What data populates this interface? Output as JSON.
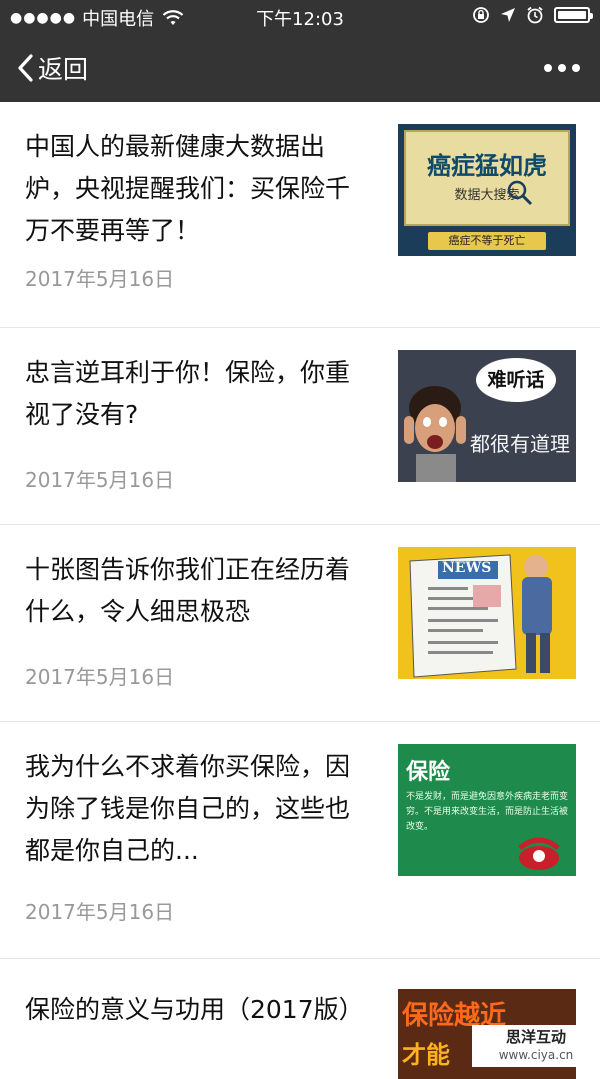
{
  "statusbar": {
    "signal": "●●●●●",
    "carrier": "中国电信",
    "time": "下午12:03"
  },
  "navbar": {
    "back_label": "返回"
  },
  "articles": [
    {
      "title": "中国人的最新健康大数据出炉，央视提醒我们：买保险千万不要再等了！",
      "date": "2017年5月16日",
      "thumb_text": {
        "main": "癌症猛如虎",
        "sub": "数据大搜索",
        "banner": "癌症不等于死亡"
      }
    },
    {
      "title": "忠言逆耳利于你！保险，你重视了没有?",
      "date": "2017年5月16日",
      "thumb_text": {
        "bubble": "难听话",
        "main": "都很有道理"
      }
    },
    {
      "title": "十张图告诉你我们正在经历着什么，令人细思极恐",
      "date": "2017年5月16日",
      "thumb_text": {
        "paper": "NEWS"
      }
    },
    {
      "title": "我为什么不求着你买保险，因为除了钱是你自己的，这些也都是你自己的...",
      "date": "2017年5月16日",
      "thumb_text": {
        "heading": "保险",
        "body": "不是发财，而是避免因意外疾病走老而变穷。不是用来改变生活，而是防止生活被改变。"
      }
    },
    {
      "title": "保险的意义与功用（2017版）",
      "date": "",
      "thumb_text": {
        "main": "保险越近",
        "sub": "才能"
      }
    }
  ],
  "watermark": {
    "name": "思洋互动",
    "url": "www.ciya.cn"
  },
  "colors": {
    "bar": "#343434",
    "date": "#999999",
    "thumb1_bg": "#e8dca0",
    "thumb4_bg": "#1e8a4c"
  }
}
